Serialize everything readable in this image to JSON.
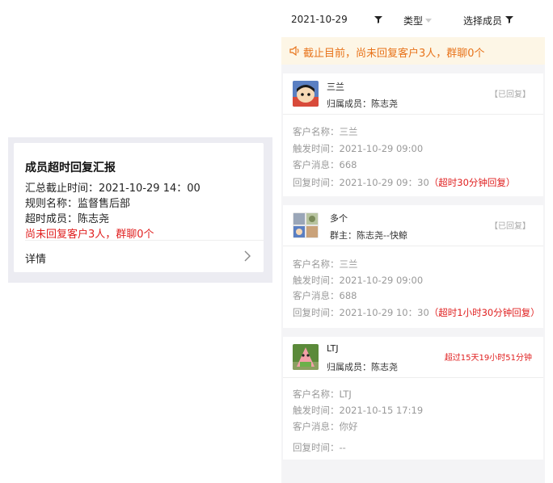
{
  "summary": {
    "title": "成员超时回复汇报",
    "cutoff_label": "汇总截止时间：",
    "cutoff_value": "2021-10-29 14：00",
    "rule_label": "规则名称：",
    "rule_value": "监督售后部",
    "member_label": "超时成员：",
    "member_value": "陈志尧",
    "unreplied": "尚未回复客户3人，群聊0个",
    "detail_label": "详情",
    "colors": {
      "alert": "#e02020"
    }
  },
  "filters": {
    "date": "2021-10-29",
    "type_label": "类型",
    "member_label": "选择成员"
  },
  "notice": {
    "text": "截止目前，尚未回复客户3人，群聊0个",
    "icon": "speaker-icon",
    "color": "#e8731a"
  },
  "labels": {
    "customer_name": "客户名称：",
    "trigger_time": "触发时间：",
    "customer_msg": "客户消息：",
    "reply_time": "回复时间："
  },
  "records": [
    {
      "name": "三兰",
      "owner_label": "归属成员：",
      "owner": "陈志尧",
      "status": "【已回复】",
      "customer_name": "三兰",
      "trigger_time": "2021-10-29 09:00",
      "message": "668",
      "reply_time": "2021-10-29 09：30",
      "late_note": "（超时30分钟回复）"
    },
    {
      "name": "多个",
      "owner_label": "群主：",
      "owner": "陈志尧--快鲸",
      "status": "【已回复】",
      "customer_name": "三兰",
      "trigger_time": "2021-10-29 09:00",
      "message": "688",
      "reply_time": "2021-10-29 10：30",
      "late_note": "（超时1小时30分钟回复）"
    },
    {
      "name": "LTJ",
      "owner_label": "归属成员：",
      "owner": "陈志尧",
      "status": "超过15天19小时51分钟",
      "customer_name": "LTJ",
      "trigger_time": "2021-10-15 17:19",
      "message": "你好",
      "reply_time": "--",
      "late_note": ""
    }
  ]
}
